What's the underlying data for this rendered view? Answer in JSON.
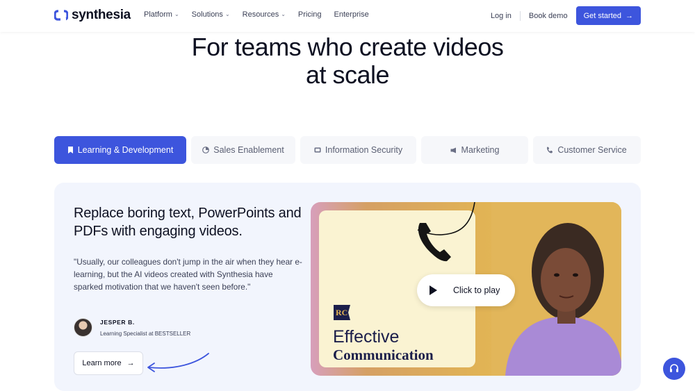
{
  "nav": {
    "logo_text": "synthesia",
    "links": [
      {
        "label": "Platform",
        "dropdown": true
      },
      {
        "label": "Solutions",
        "dropdown": true
      },
      {
        "label": "Resources",
        "dropdown": true
      },
      {
        "label": "Pricing",
        "dropdown": false
      },
      {
        "label": "Enterprise",
        "dropdown": false
      }
    ],
    "login": "Log in",
    "book_demo": "Book demo",
    "get_started": "Get started",
    "get_started_icon": "arrow-right-icon"
  },
  "hero": {
    "title_line1": "For teams who create videos",
    "title_line2": "at scale"
  },
  "tabs": [
    {
      "label": "Learning & Development",
      "icon": "bookmark-icon",
      "active": true
    },
    {
      "label": "Sales Enablement",
      "icon": "pie-chart-icon",
      "active": false
    },
    {
      "label": "Information Security",
      "icon": "monitor-icon",
      "active": false
    },
    {
      "label": "Marketing",
      "icon": "megaphone-icon",
      "active": false
    },
    {
      "label": "Customer Service",
      "icon": "phone-icon",
      "active": false
    }
  ],
  "panel": {
    "heading": "Replace boring text, PowerPoints and PDFs with engaging videos.",
    "quote": "\"Usually, our colleagues don't jump in the air when they hear e-learning, but the AI videos created with Synthesia have sparked motivation that we haven't seen before.\"",
    "author_name": "JESPER B.",
    "author_role": "Learning Specialist at BESTSELLER",
    "learn_more": "Learn more"
  },
  "video": {
    "badge": "RC",
    "card_line1": "Effective",
    "card_line2": "Communication",
    "play_label": "Click to play"
  },
  "colors": {
    "accent": "#3d55dd",
    "panel_bg": "#f2f5fd",
    "tab_bg": "#f6f7fa",
    "text_dark": "#0d1021"
  }
}
